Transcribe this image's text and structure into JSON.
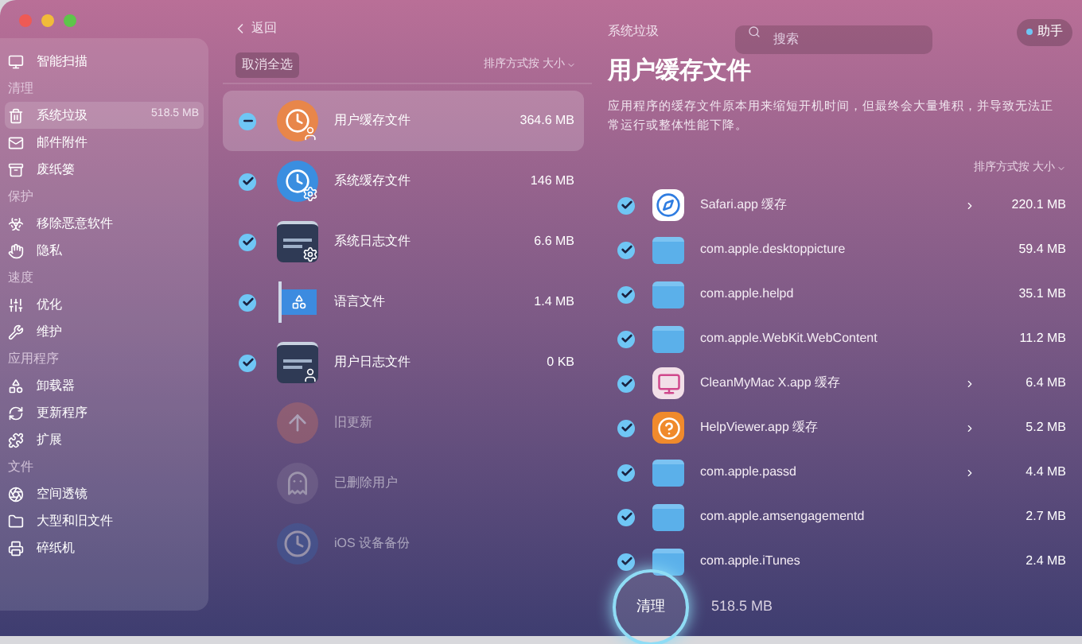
{
  "sidebar": {
    "items": [
      {
        "kind": "item",
        "label": "智能扫描",
        "selected": false
      },
      {
        "kind": "header",
        "label": "清理"
      },
      {
        "kind": "item",
        "label": "系统垃圾",
        "selected": true,
        "badge": "518.5 MB"
      },
      {
        "kind": "item",
        "label": "邮件附件",
        "selected": false
      },
      {
        "kind": "item",
        "label": "废纸篓",
        "selected": false
      },
      {
        "kind": "header",
        "label": "保护"
      },
      {
        "kind": "item",
        "label": "移除恶意软件",
        "selected": false
      },
      {
        "kind": "item",
        "label": "隐私",
        "selected": false
      },
      {
        "kind": "header",
        "label": "速度"
      },
      {
        "kind": "item",
        "label": "优化",
        "selected": false
      },
      {
        "kind": "item",
        "label": "维护",
        "selected": false
      },
      {
        "kind": "header",
        "label": "应用程序"
      },
      {
        "kind": "item",
        "label": "卸载器",
        "selected": false
      },
      {
        "kind": "item",
        "label": "更新程序",
        "selected": false
      },
      {
        "kind": "item",
        "label": "扩展",
        "selected": false
      },
      {
        "kind": "header",
        "label": "文件"
      },
      {
        "kind": "item",
        "label": "空间透镜",
        "selected": false
      },
      {
        "kind": "item",
        "label": "大型和旧文件",
        "selected": false
      },
      {
        "kind": "item",
        "label": "碎纸机",
        "selected": false
      }
    ]
  },
  "back": "返回",
  "deselect_all": "取消全选",
  "middle_sort": "排序方式按 大小",
  "categories": [
    {
      "label": "用户缓存文件",
      "size": "364.6 MB",
      "checked": true,
      "mixed": true,
      "selected": true,
      "disabled": false
    },
    {
      "label": "系统缓存文件",
      "size": "146 MB",
      "checked": true,
      "mixed": false,
      "selected": false,
      "disabled": false
    },
    {
      "label": "系统日志文件",
      "size": "6.6 MB",
      "checked": true,
      "mixed": false,
      "selected": false,
      "disabled": false
    },
    {
      "label": "语言文件",
      "size": "1.4 MB",
      "checked": true,
      "mixed": false,
      "selected": false,
      "disabled": false
    },
    {
      "label": "用户日志文件",
      "size": "0 KB",
      "checked": true,
      "mixed": false,
      "selected": false,
      "disabled": false
    },
    {
      "label": "旧更新",
      "checked": false,
      "mixed": false,
      "selected": false,
      "disabled": true
    },
    {
      "label": "已删除用户",
      "checked": false,
      "mixed": false,
      "selected": false,
      "disabled": true
    },
    {
      "label": "iOS 设备备份",
      "checked": false,
      "mixed": false,
      "selected": false,
      "disabled": true
    }
  ],
  "section_title": "系统垃圾",
  "search": {
    "placeholder": "搜索"
  },
  "assistant": "助手",
  "detail": {
    "title": "用户缓存文件",
    "description": "应用程序的缓存文件原本用来缩短开机时间，但最终会大量堆积，并导致无法正常运行或整体性能下降。",
    "sort": "排序方式按 大小"
  },
  "files": [
    {
      "name": "Safari.app 缓存",
      "size": "220.1 MB",
      "checked": true,
      "expandable": true
    },
    {
      "name": "com.apple.desktoppicture",
      "size": "59.4 MB",
      "checked": true,
      "expandable": false
    },
    {
      "name": "com.apple.helpd",
      "size": "35.1 MB",
      "checked": true,
      "expandable": false
    },
    {
      "name": "com.apple.WebKit.WebContent",
      "size": "11.2 MB",
      "checked": true,
      "expandable": false
    },
    {
      "name": "CleanMyMac X.app 缓存",
      "size": "6.4 MB",
      "checked": true,
      "expandable": true
    },
    {
      "name": "HelpViewer.app 缓存",
      "size": "5.2 MB",
      "checked": true,
      "expandable": true
    },
    {
      "name": "com.apple.passd",
      "size": "4.4 MB",
      "checked": true,
      "expandable": true
    },
    {
      "name": "com.apple.amsengagementd",
      "size": "2.7 MB",
      "checked": true,
      "expandable": false
    },
    {
      "name": "com.apple.iTunes",
      "size": "2.4 MB",
      "checked": true,
      "expandable": false
    }
  ],
  "clean_button": "清理",
  "total": "518.5 MB"
}
